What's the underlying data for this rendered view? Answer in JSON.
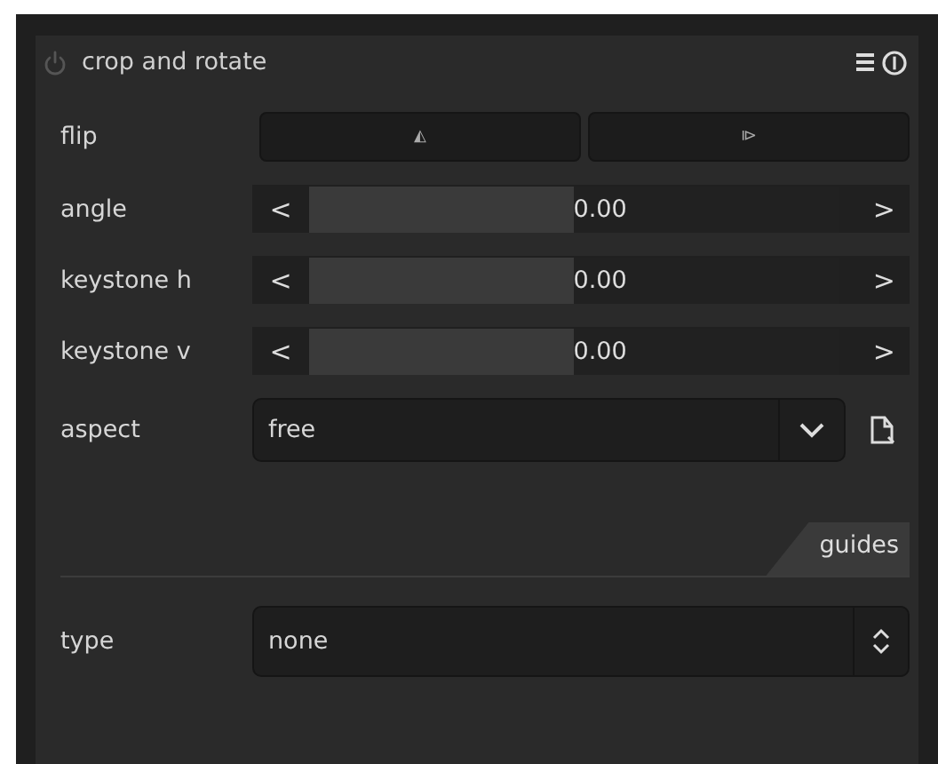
{
  "module": {
    "title": "crop and rotate",
    "enabled": false
  },
  "flip": {
    "label": "flip",
    "buttons": [
      "◭",
      "⧐"
    ]
  },
  "sliders": [
    {
      "label": "angle",
      "decrease": "<",
      "increase": ">",
      "value": "0.00",
      "level": 0.5
    },
    {
      "label": "keystone h",
      "decrease": "<",
      "increase": ">",
      "value": "0.00",
      "level": 0.5
    },
    {
      "label": "keystone v",
      "decrease": "<",
      "increase": ">",
      "value": "0.00",
      "level": 0.5
    }
  ],
  "aspect": {
    "label": "aspect",
    "value": "free"
  },
  "section": {
    "label": "guides"
  },
  "type": {
    "label": "type",
    "value": "none"
  }
}
